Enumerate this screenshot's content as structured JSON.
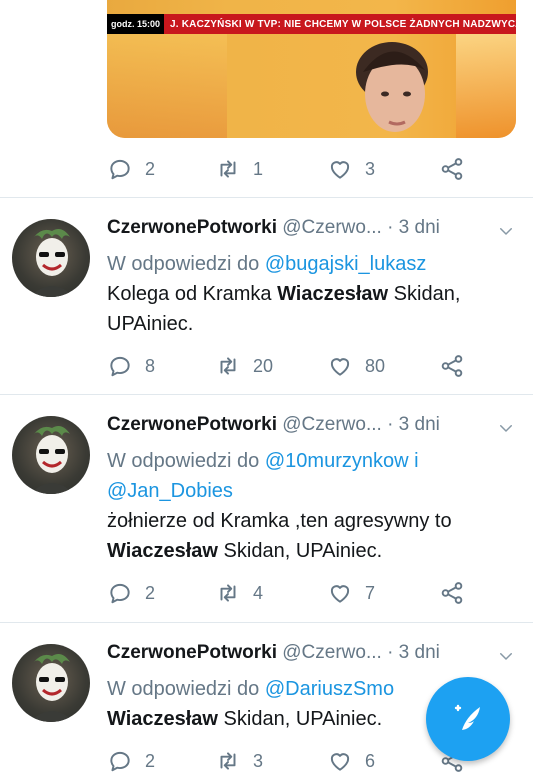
{
  "media": {
    "ticker_time": "godz. 15:00",
    "ticker_headline": "J. KACZYŃSKI W TVP: NIE CHCEMY W POLSCE ŻADNYCH NADZWYCZAJNYCH KAST"
  },
  "top_actions": {
    "replies": "2",
    "retweets": "1",
    "likes": "3"
  },
  "tweets": [
    {
      "name": "CzerwonePotworki",
      "handle": "@Czerwo...",
      "time": "· 3 dni",
      "reply_prefix": "W odpowiedzi do",
      "reply_to_1": "@bugajski_lukasz",
      "reply_to_2": "",
      "text_lines": [
        "Kolega od Kramka ",
        "Wiaczesław",
        " Skidan,",
        "UPAiniec."
      ],
      "replies": "8",
      "retweets": "20",
      "likes": "80"
    },
    {
      "name": "CzerwonePotworki",
      "handle": "@Czerwo...",
      "time": "· 3 dni",
      "reply_prefix": "W odpowiedzi do",
      "reply_to_1": "@10murzynkow i",
      "reply_to_2": "@Jan_Dobies",
      "text_lines": [
        "żołnierze od Kramka ,ten agresywny to",
        "Wiaczesław",
        " Skidan, UPAiniec."
      ],
      "replies": "2",
      "retweets": "4",
      "likes": "7"
    },
    {
      "name": "CzerwonePotworki",
      "handle": "@Czerwo...",
      "time": "· 3 dni",
      "reply_prefix": "W odpowiedzi do",
      "reply_to_1": "@DariuszSmo",
      "reply_to_2": "",
      "text_lines": [
        "Wiaczesław",
        " Skidan, UPAiniec."
      ],
      "replies": "2",
      "retweets": "3",
      "likes": "6"
    }
  ],
  "icons": [
    "reply-icon",
    "retweet-icon",
    "like-icon",
    "share-icon",
    "chevron-down-icon",
    "compose-icon"
  ],
  "colors": {
    "accent": "#1da1f2",
    "link": "#1b95e0",
    "muted": "#657786"
  }
}
